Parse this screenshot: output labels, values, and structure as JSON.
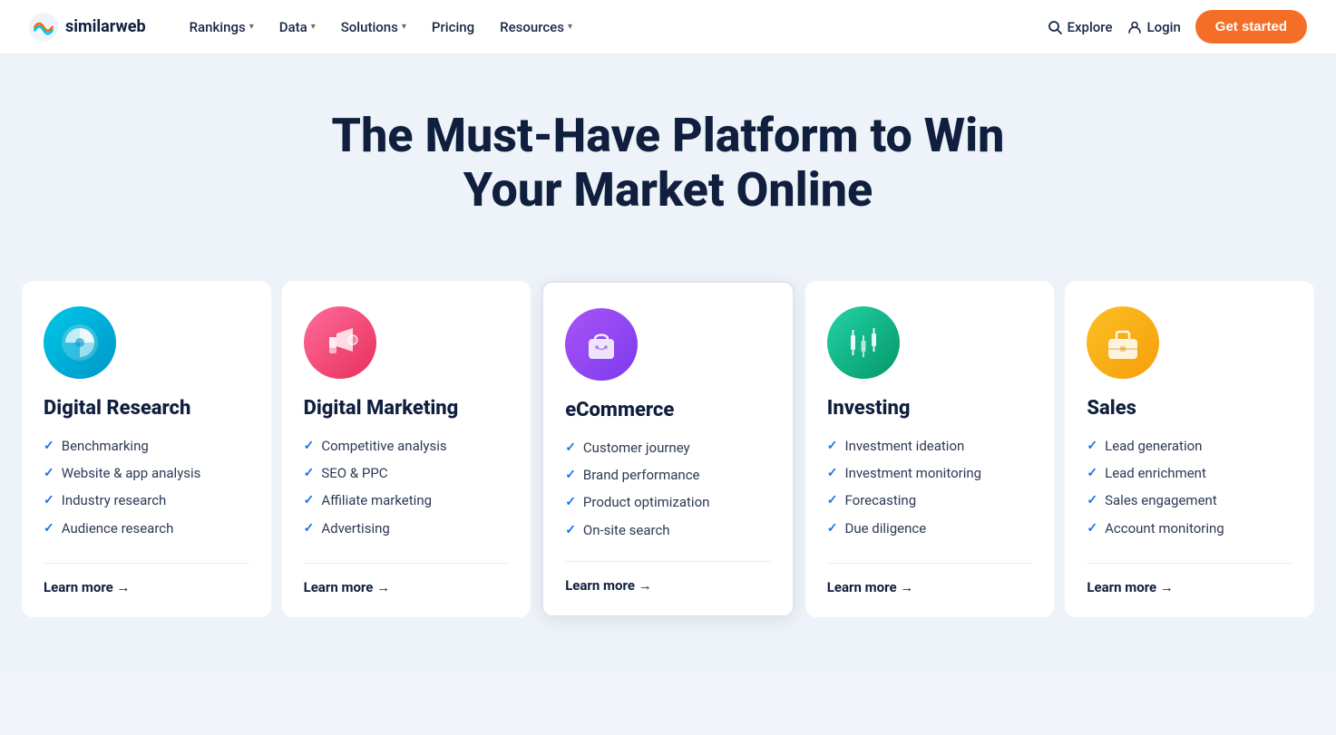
{
  "nav": {
    "logo_text": "similarweb",
    "links": [
      {
        "label": "Rankings",
        "has_dropdown": true
      },
      {
        "label": "Data",
        "has_dropdown": true
      },
      {
        "label": "Solutions",
        "has_dropdown": true
      },
      {
        "label": "Pricing",
        "has_dropdown": false
      },
      {
        "label": "Resources",
        "has_dropdown": true
      }
    ],
    "explore_label": "Explore",
    "login_label": "Login",
    "cta_label": "Get started"
  },
  "hero": {
    "title": "The Must-Have Platform to Win Your Market Online"
  },
  "cards": [
    {
      "id": "digital-research",
      "icon_bg": "icon-cyan",
      "icon_symbol": "🔵",
      "title": "Digital Research",
      "items": [
        "Benchmarking",
        "Website & app analysis",
        "Industry research",
        "Audience research"
      ],
      "learn_more": "Learn more →",
      "highlighted": false
    },
    {
      "id": "digital-marketing",
      "icon_bg": "icon-pink",
      "icon_symbol": "📣",
      "title": "Digital Marketing",
      "items": [
        "Competitive analysis",
        "SEO & PPC",
        "Affiliate marketing",
        "Advertising"
      ],
      "learn_more": "Learn more →",
      "highlighted": false
    },
    {
      "id": "ecommerce",
      "icon_bg": "icon-purple",
      "icon_symbol": "🛍",
      "title": "eCommerce",
      "items": [
        "Customer journey",
        "Brand performance",
        "Product optimization",
        "On-site search"
      ],
      "learn_more": "Learn more →",
      "highlighted": true
    },
    {
      "id": "investing",
      "icon_bg": "icon-green",
      "icon_symbol": "📊",
      "title": "Investing",
      "items": [
        "Investment ideation",
        "Investment monitoring",
        "Forecasting",
        "Due diligence"
      ],
      "learn_more": "Learn more →",
      "highlighted": false
    },
    {
      "id": "sales",
      "icon_bg": "icon-orange",
      "icon_symbol": "💼",
      "title": "Sales",
      "items": [
        "Lead generation",
        "Lead enrichment",
        "Sales engagement",
        "Account monitoring"
      ],
      "learn_more": "Learn more →",
      "highlighted": false
    }
  ]
}
